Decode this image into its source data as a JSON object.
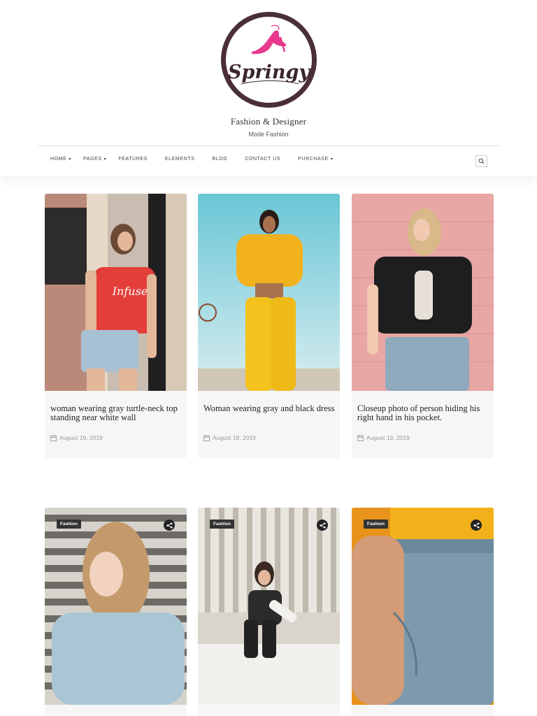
{
  "site": {
    "logo_text": "Springy",
    "title": "Fashion & Designer",
    "tagline": "Mode Fashion"
  },
  "nav": {
    "items": [
      {
        "label": "HOME",
        "dropdown": true
      },
      {
        "label": "PAGES",
        "dropdown": true
      },
      {
        "label": "FEATURES",
        "dropdown": false
      },
      {
        "label": "ELEMENTS",
        "dropdown": false
      },
      {
        "label": "BLOG",
        "dropdown": false
      },
      {
        "label": "CONTACT US",
        "dropdown": false
      },
      {
        "label": "PURCHASE",
        "dropdown": true
      }
    ],
    "search_icon": "search-icon"
  },
  "posts_row1": [
    {
      "title": "woman wearing gray turtle-neck top standing near white wall",
      "date": "August 19, 2019"
    },
    {
      "title": "Woman wearing gray and black dress",
      "date": "August 19, 2019"
    },
    {
      "title": "Closeup photo of person hiding his right hand in his pocket.",
      "date": "August 19, 2019"
    }
  ],
  "posts_row2": [
    {
      "category": "Fashion"
    },
    {
      "category": "Fashion"
    },
    {
      "category": "Fashion"
    }
  ],
  "colors": {
    "logo_ring": "#4a2e3a",
    "logo_accent": "#e8398e",
    "card_bg": "#f6f6f6"
  }
}
